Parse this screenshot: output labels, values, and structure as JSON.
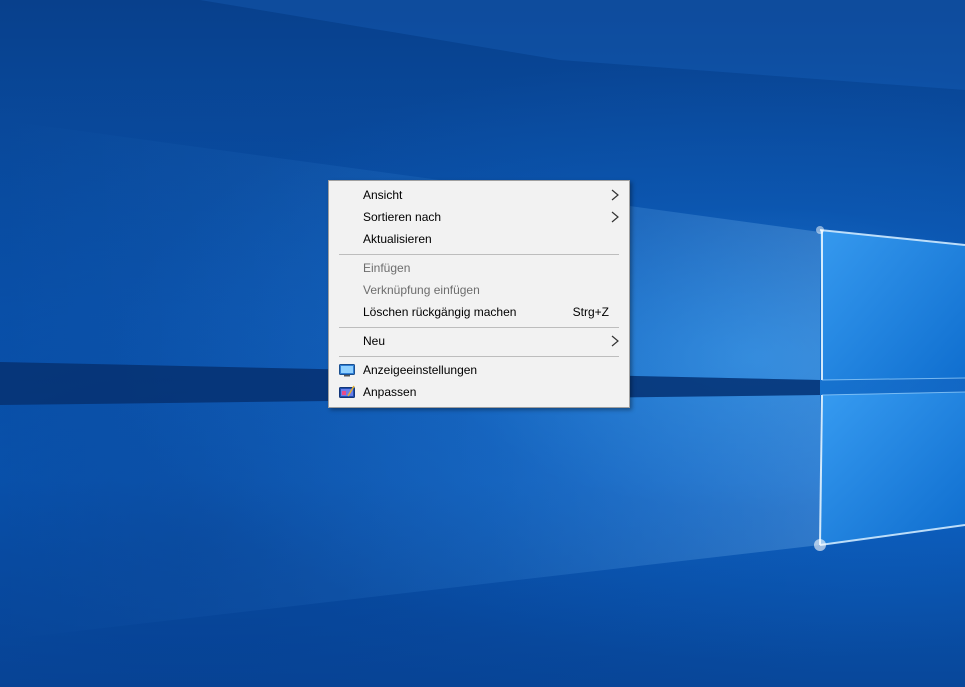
{
  "context_menu": {
    "items": [
      {
        "label": "Ansicht",
        "submenu": true
      },
      {
        "label": "Sortieren nach",
        "submenu": true
      },
      {
        "label": "Aktualisieren"
      },
      {
        "label": "Einfügen",
        "disabled": true
      },
      {
        "label": "Verknüpfung einfügen",
        "disabled": true
      },
      {
        "label": "Löschen rückgängig machen",
        "shortcut": "Strg+Z"
      },
      {
        "label": "Neu",
        "submenu": true
      },
      {
        "label": "Anzeigeeinstellungen",
        "icon": "display-settings-icon"
      },
      {
        "label": "Anpassen",
        "icon": "personalize-icon"
      }
    ]
  },
  "colors": {
    "menu_background": "#f2f2f2",
    "disabled_text": "#6d6d6d",
    "wallpaper_blue": "#0a55b0"
  }
}
